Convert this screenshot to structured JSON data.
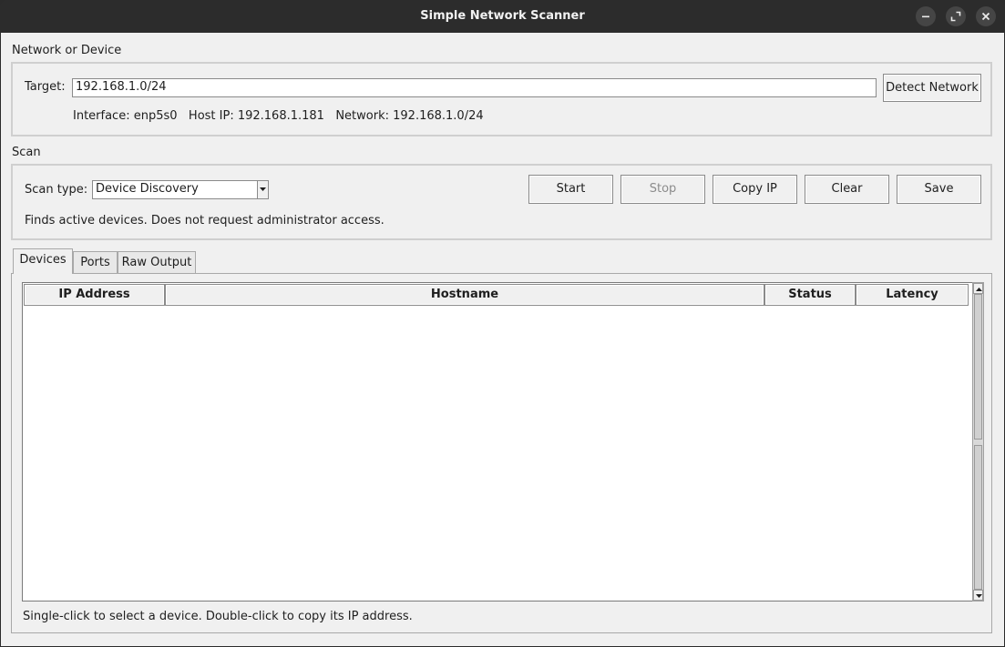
{
  "window": {
    "title": "Simple Network Scanner"
  },
  "network_group": {
    "label": "Network or Device",
    "target_label": "Target:",
    "target_value": "192.168.1.0/24",
    "detect_button": "Detect Network",
    "info": "Interface: enp5s0   Host IP: 192.168.1.181   Network: 192.168.1.0/24"
  },
  "scan_group": {
    "label": "Scan",
    "scan_type_label": "Scan type:",
    "scan_type_value": "Device Discovery",
    "description": "Finds active devices. Does not request administrator access.",
    "buttons": {
      "start": "Start",
      "stop": "Stop",
      "copy_ip": "Copy IP",
      "clear": "Clear",
      "save": "Save"
    }
  },
  "tabs": [
    {
      "label": "Devices",
      "active": true
    },
    {
      "label": "Ports",
      "active": false
    },
    {
      "label": "Raw Output",
      "active": false
    }
  ],
  "table": {
    "columns": [
      "IP Address",
      "Hostname",
      "Status",
      "Latency"
    ],
    "rows": []
  },
  "hint": "Single-click to select a device. Double-click to copy its IP address."
}
